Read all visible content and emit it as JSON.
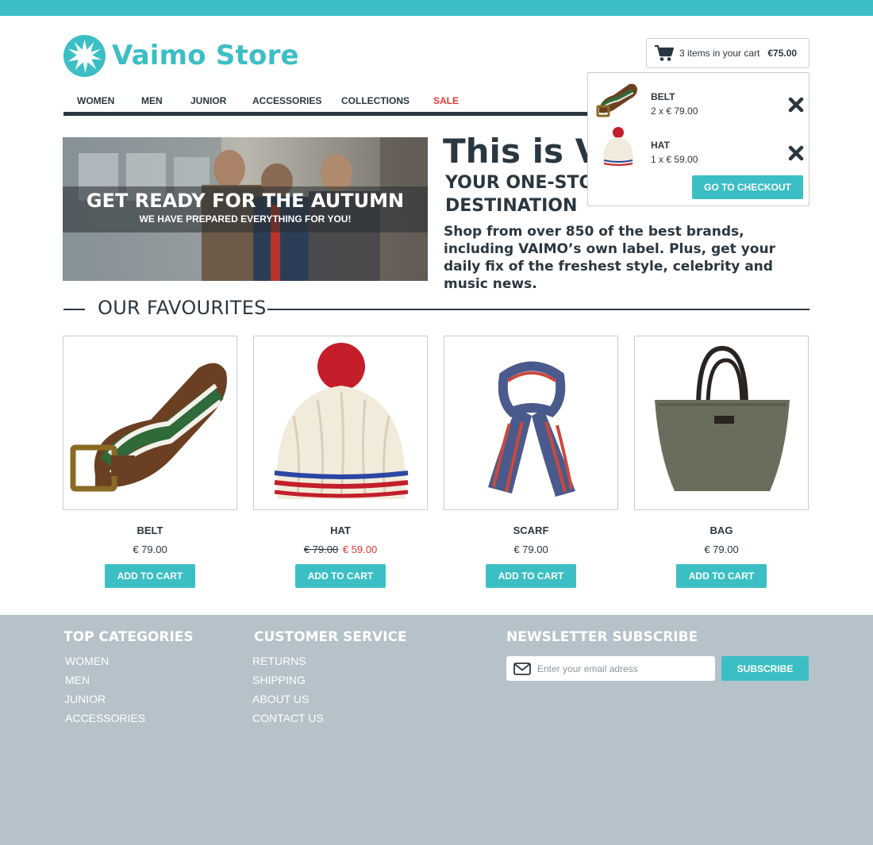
{
  "brand": {
    "name": "Vaimo Store",
    "color": "#3bbfc4",
    "icon": "starburst-logo-icon"
  },
  "cart": {
    "count_text": "3 items in your cart",
    "total": "€75.00",
    "icon": "cart-icon",
    "items": [
      {
        "name": "BELT",
        "qty": "2 x € 79.00"
      },
      {
        "name": "HAT",
        "qty": "1 x € 59.00"
      }
    ],
    "checkout_label": "GO TO CHECKOUT"
  },
  "nav": {
    "items": [
      "WOMEN",
      "MEN",
      "JUNIOR",
      "ACCESSORIES",
      "COLLECTIONS",
      "SALE"
    ],
    "sale_color": "#e53935"
  },
  "hero": {
    "title": "GET READY FOR THE AUTUMN",
    "subtitle": "WE HAVE PREPARED EVERYTHING FOR YOU!"
  },
  "intro": {
    "title": "This is Vaimo",
    "subtitle": "YOUR ONE-STOP FASHION DESTINATION",
    "text": "Shop from over 850 of the best brands, including VAIMO’s own label. Plus, get your daily fix of the freshest style, celebrity and music news."
  },
  "favourites": {
    "title": "OUR FAVOURITES",
    "products": [
      {
        "name": "BELT",
        "price": "€ 79.00",
        "button": "ADD TO CART"
      },
      {
        "name": "HAT",
        "old_price": "€ 79.00",
        "sale_price": "€ 59.00",
        "button": "ADD TO CART"
      },
      {
        "name": "SCARF",
        "price": "€ 79.00",
        "button": "ADD TO CART"
      },
      {
        "name": "BAG",
        "price": "€ 79.00",
        "button": "ADD TO CART"
      }
    ]
  },
  "footer": {
    "top_categories": {
      "title": "TOP CATEGORIES",
      "links": [
        "WOMEN",
        "MEN",
        "JUNIOR",
        "ACCESSORIES"
      ]
    },
    "customer_service": {
      "title": "CUSTOMER SERVICE",
      "links": [
        "RETURNS",
        "SHIPPING",
        "ABOUT US",
        "CONTACT US"
      ]
    },
    "newsletter": {
      "title": "NEWSLETTER SUBSCRIBE",
      "placeholder": "Enter your email adress",
      "button": "SUBSCRIBE"
    },
    "background": "#b5c2c9"
  }
}
